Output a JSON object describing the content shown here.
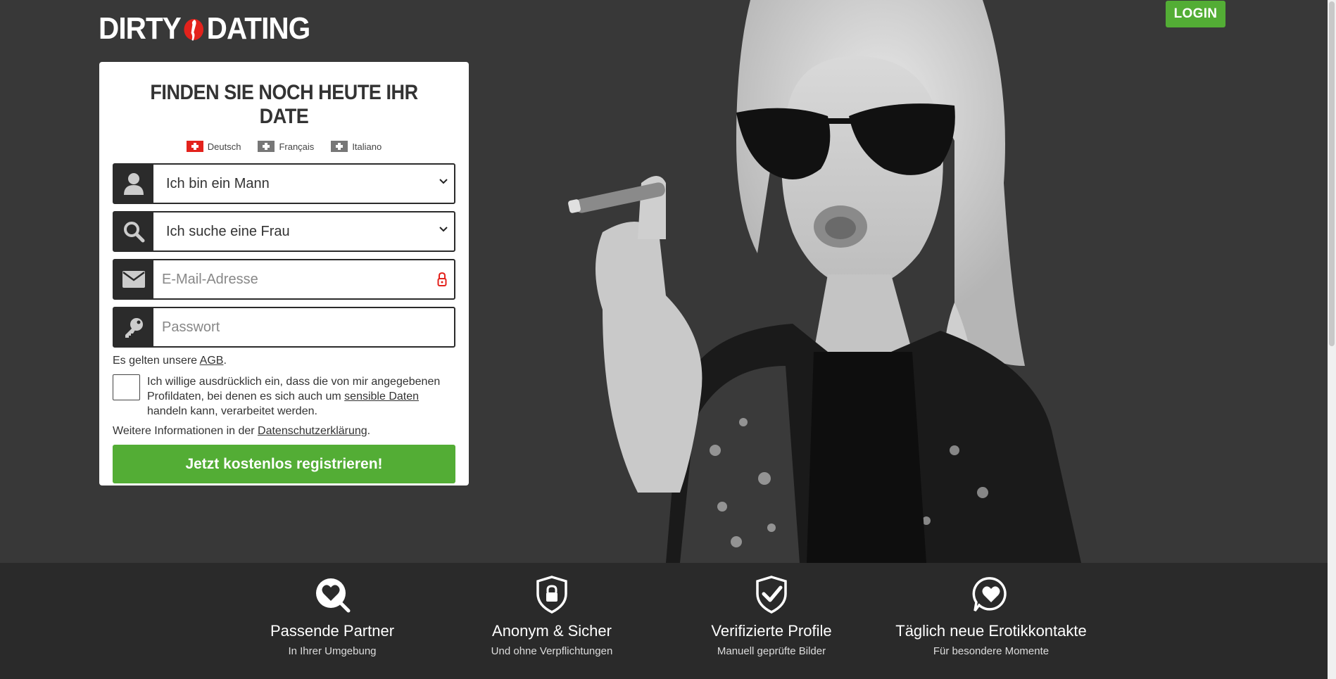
{
  "brand": {
    "left": "DIRTY",
    "right": "DATING"
  },
  "header": {
    "login_label": "LOGIN"
  },
  "form": {
    "title": "FINDEN SIE NOCH HEUTE IHR DATE",
    "languages": [
      {
        "label": "Deutsch",
        "active": true
      },
      {
        "label": "Français",
        "active": false
      },
      {
        "label": "Italiano",
        "active": false
      }
    ],
    "gender_select": "Ich bin ein Mann",
    "seeking_select": "Ich suche eine Frau",
    "email_placeholder": "E-Mail-Adresse",
    "password_placeholder": "Passwort",
    "agb_prefix": "Es gelten unsere ",
    "agb_link": "AGB",
    "agb_suffix": ".",
    "consent_prefix": "Ich willige ausdrücklich ein, dass die von mir angegebenen Profildaten, bei denen es sich auch um ",
    "consent_link": "sensible Daten",
    "consent_suffix": " handeln kann, verarbeitet werden.",
    "privacy_prefix": "Weitere Informationen in der ",
    "privacy_link": "Datenschutzerklärung",
    "privacy_suffix": ".",
    "register_label": "Jetzt kostenlos registrieren!"
  },
  "features": [
    {
      "icon": "heart-search-icon",
      "title": "Passende Partner",
      "subtitle": "In Ihrer Umgebung"
    },
    {
      "icon": "shield-lock-icon",
      "title": "Anonym & Sicher",
      "subtitle": "Und ohne Verpflichtungen"
    },
    {
      "icon": "shield-check-icon",
      "title": "Verifizierte Profile",
      "subtitle": "Manuell geprüfte Bilder"
    },
    {
      "icon": "heart-chat-icon",
      "title": "Täglich neue Erotikkontakte",
      "subtitle": "Für besondere Momente"
    }
  ],
  "colors": {
    "accent_green": "#53ad35",
    "background": "#383838",
    "footer_bar": "#2a2a2a",
    "brand_red": "#e3221c"
  }
}
